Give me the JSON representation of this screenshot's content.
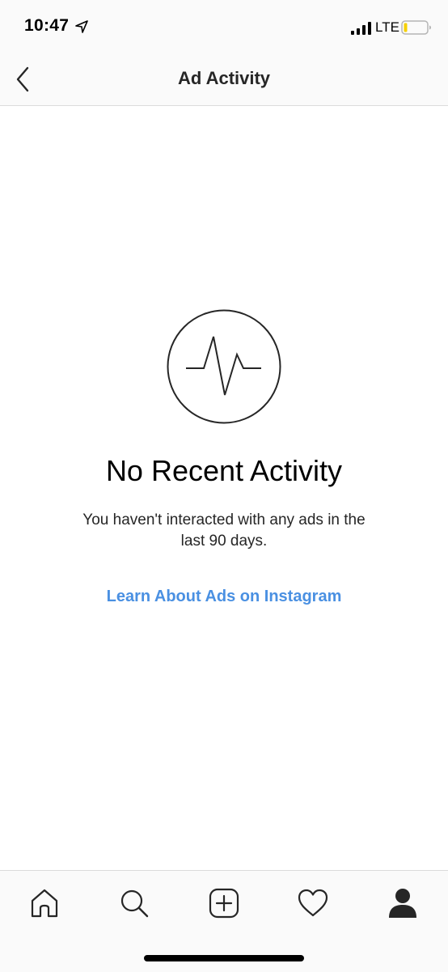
{
  "status_bar": {
    "time": "10:47",
    "network": "LTE",
    "icons": [
      "location-arrow-icon",
      "signal-bars-icon",
      "battery-icon"
    ]
  },
  "nav": {
    "title": "Ad Activity",
    "back_icon": "chevron-left-icon"
  },
  "empty_state": {
    "icon": "activity-pulse-icon",
    "title": "No Recent Activity",
    "description": "You haven't interacted with any ads in the last 90 days.",
    "link_label": "Learn About Ads on Instagram",
    "link_color": "#4a90e2"
  },
  "tab_bar": {
    "tabs": [
      {
        "icon": "home-icon"
      },
      {
        "icon": "search-icon"
      },
      {
        "icon": "add-post-icon"
      },
      {
        "icon": "heart-icon"
      },
      {
        "icon": "profile-icon",
        "selected": true
      }
    ]
  }
}
